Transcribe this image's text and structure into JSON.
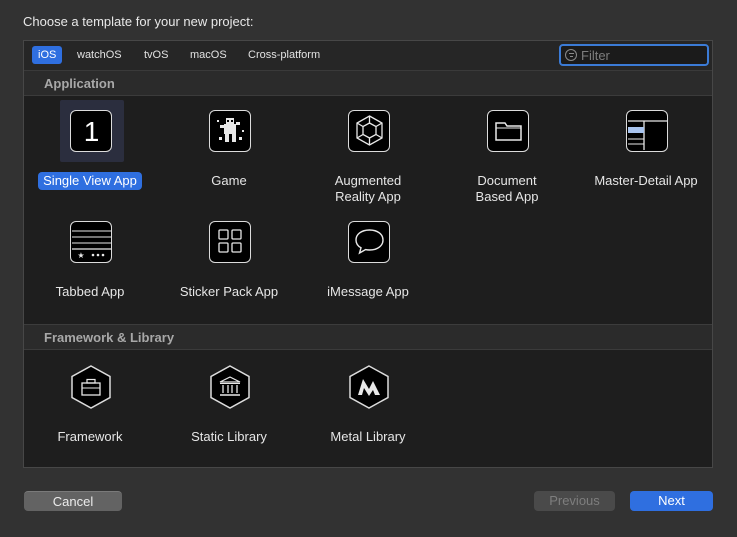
{
  "dialog": {
    "title": "Choose a template for your new project:"
  },
  "platform_tabs": [
    {
      "label": "iOS",
      "selected": true
    },
    {
      "label": "watchOS",
      "selected": false
    },
    {
      "label": "tvOS",
      "selected": false
    },
    {
      "label": "macOS",
      "selected": false
    },
    {
      "label": "Cross-platform",
      "selected": false
    }
  ],
  "filter": {
    "placeholder": "Filter",
    "value": ""
  },
  "sections": [
    {
      "title": "Application",
      "templates": [
        {
          "label": "Single View App",
          "icon": "single-view-icon",
          "selected": true
        },
        {
          "label": "Game",
          "icon": "game-icon",
          "selected": false
        },
        {
          "label": "Augmented\nReality App",
          "icon": "augmented-reality-icon",
          "selected": false
        },
        {
          "label": "Document\nBased App",
          "icon": "document-folder-icon",
          "selected": false
        },
        {
          "label": "Master-Detail App",
          "icon": "master-detail-icon",
          "selected": false
        },
        {
          "label": "Tabbed App",
          "icon": "tabbed-app-icon",
          "selected": false
        },
        {
          "label": "Sticker Pack App",
          "icon": "sticker-grid-icon",
          "selected": false
        },
        {
          "label": "iMessage App",
          "icon": "message-bubble-icon",
          "selected": false
        }
      ]
    },
    {
      "title": "Framework & Library",
      "templates": [
        {
          "label": "Framework",
          "icon": "toolbox-icon",
          "selected": false
        },
        {
          "label": "Static Library",
          "icon": "library-building-icon",
          "selected": false
        },
        {
          "label": "Metal Library",
          "icon": "metal-icon",
          "selected": false
        }
      ]
    }
  ],
  "buttons": {
    "cancel": "Cancel",
    "previous": "Previous",
    "next": "Next"
  },
  "colors": {
    "accent": "#2f6fe0",
    "window_bg": "#323232",
    "panel_bg": "#1e1e1e"
  }
}
